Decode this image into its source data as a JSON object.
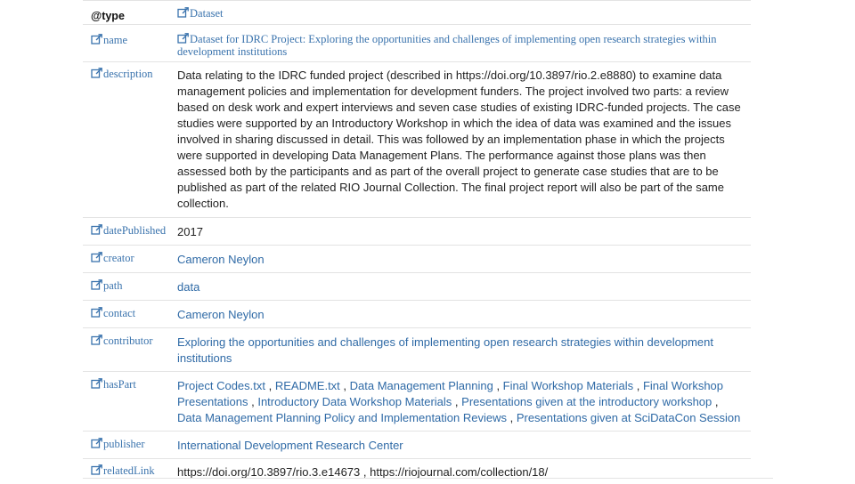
{
  "rows": [
    {
      "key": "@type",
      "key_icon": false,
      "value_style": "serif",
      "value_icon": true,
      "value": "Dataset"
    },
    {
      "key": "name",
      "key_icon": true,
      "value_style": "serif",
      "value_icon": true,
      "value": "Dataset for IDRC Project: Exploring the opportunities and challenges of implementing open research strategies within development institutions"
    },
    {
      "key": "description",
      "key_icon": true,
      "value_style": "text",
      "value_icon": false,
      "value": "Data relating to the IDRC funded project (described in https://doi.org/10.3897/rio.2.e8880) to examine data management policies and implementation for development funders. The project involved two parts: a review based on desk work and expert interviews and seven case studies of existing IDRC-funded projects. The case studies were supported by an Introductory Workshop in which the idea of data was examined and the issues involved in sharing discussed in detail. This was followed by an implementation phase in which the projects were supported in developing Data Management Plans. The performance against those plans was then assessed both by the participants and as part of the overall project to generate case studies that are to be published as part of the related RIO Journal Collection. The final project report will also be part of the same collection."
    },
    {
      "key": "datePublished",
      "key_icon": true,
      "value_style": "text",
      "value_icon": false,
      "value": "2017"
    },
    {
      "key": "creator",
      "key_icon": true,
      "value_style": "link",
      "value_icon": false,
      "value": "Cameron Neylon"
    },
    {
      "key": "path",
      "key_icon": true,
      "value_style": "link",
      "value_icon": false,
      "value": "data"
    },
    {
      "key": "contact",
      "key_icon": true,
      "value_style": "link",
      "value_icon": false,
      "value": "Cameron Neylon"
    },
    {
      "key": "contributor",
      "key_icon": true,
      "value_style": "link",
      "value_icon": false,
      "value": "Exploring the opportunities and challenges of implementing open research strategies within development institutions"
    },
    {
      "key": "hasPart",
      "key_icon": true,
      "value_style": "list",
      "value_icon": false,
      "items": [
        "Project Codes.txt",
        "README.txt",
        "Data Management Planning",
        "Final Workshop Materials",
        "Final Workshop Presentations",
        "Introductory Data Workshop Materials",
        "Presentations given at the introductory workshop",
        "Data Management Planning Policy and Implementation Reviews",
        "Presentations given at SciDataCon Session"
      ]
    },
    {
      "key": "publisher",
      "key_icon": true,
      "value_style": "link",
      "value_icon": false,
      "value": "International Development Research Center"
    },
    {
      "key": "relatedLink",
      "key_icon": true,
      "value_style": "text",
      "value_icon": false,
      "value": "https://doi.org/10.3897/rio.3.e14673 , https://riojournal.com/collection/18/"
    }
  ],
  "colors": {
    "link": "#2f6aa6",
    "border": "#e3e3e3",
    "text": "#222222"
  }
}
